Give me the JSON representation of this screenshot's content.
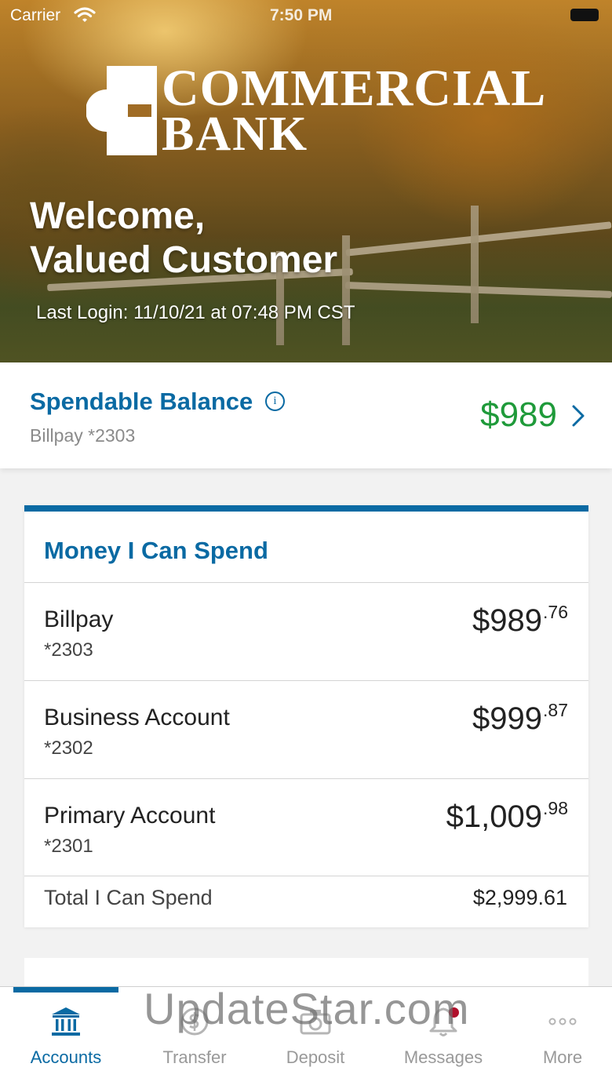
{
  "status_bar": {
    "carrier": "Carrier",
    "time": "7:50 PM"
  },
  "logo": {
    "line1": "COMMERCIAL",
    "line2": "BANK"
  },
  "hero": {
    "welcome_line1": "Welcome,",
    "welcome_line2": "Valued Customer",
    "last_login": "Last Login: 11/10/21 at 07:48 PM CST"
  },
  "spendable": {
    "title": "Spendable Balance",
    "info_icon": "info-icon",
    "account": "Billpay *2303",
    "amount": "$989"
  },
  "money_card": {
    "title": "Money I Can Spend",
    "accounts": [
      {
        "name": "Billpay",
        "number": "*2303",
        "amount_main": "$989",
        "amount_cents": ".76"
      },
      {
        "name": "Business Account",
        "number": "*2302",
        "amount_main": "$999",
        "amount_cents": ".87"
      },
      {
        "name": "Primary Account",
        "number": "*2301",
        "amount_main": "$1,009",
        "amount_cents": ".98"
      }
    ],
    "total_label": "Total I Can Spend",
    "total_value": "$2,999.61"
  },
  "tabs": [
    {
      "label": "Accounts",
      "icon": "bank-icon",
      "active": true
    },
    {
      "label": "Transfer",
      "icon": "transfer-dollar-icon",
      "active": false
    },
    {
      "label": "Deposit",
      "icon": "camera-icon",
      "active": false
    },
    {
      "label": "Messages",
      "icon": "bell-icon",
      "active": false,
      "badge": true
    },
    {
      "label": "More",
      "icon": "more-dots-icon",
      "active": false
    }
  ],
  "watermark": "UpdateStar.com",
  "colors": {
    "brand_blue": "#0a6aa3",
    "positive_green": "#1f9a3a",
    "badge_red": "#b0102c"
  }
}
